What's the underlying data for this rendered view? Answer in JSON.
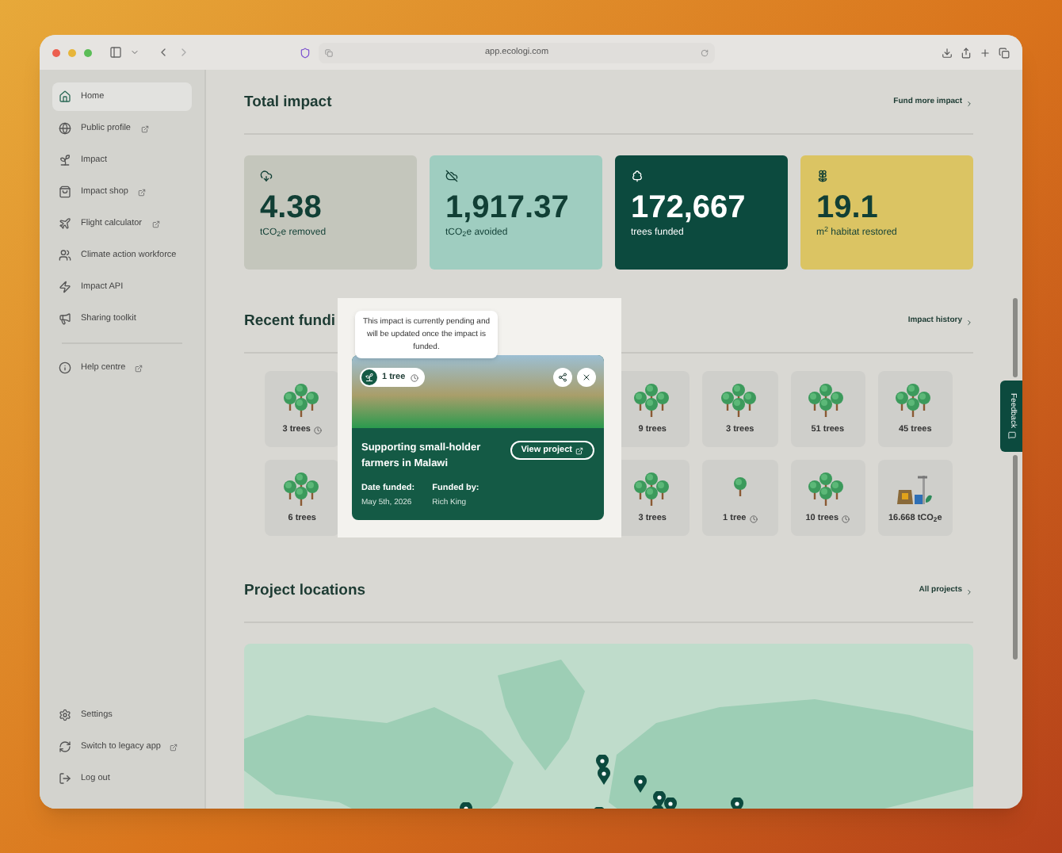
{
  "browser": {
    "url": "app.ecologi.com"
  },
  "sidebar": {
    "items": [
      {
        "label": "Home",
        "selected": true,
        "external": false
      },
      {
        "label": "Public profile",
        "selected": false,
        "external": true
      },
      {
        "label": "Impact",
        "selected": false,
        "external": false
      },
      {
        "label": "Impact shop",
        "selected": false,
        "external": true
      },
      {
        "label": "Flight calculator",
        "selected": false,
        "external": true
      },
      {
        "label": "Climate action workforce",
        "selected": false,
        "external": false
      },
      {
        "label": "Impact API",
        "selected": false,
        "external": false
      },
      {
        "label": "Sharing toolkit",
        "selected": false,
        "external": false
      }
    ],
    "help": [
      {
        "label": "Help centre",
        "selected": false,
        "external": true
      }
    ],
    "footer": [
      {
        "label": "Settings",
        "external": false
      },
      {
        "label": "Switch to legacy app",
        "external": true
      },
      {
        "label": "Log out",
        "external": false
      }
    ]
  },
  "total_impact": {
    "title": "Total impact",
    "link": "Fund more impact",
    "cards": [
      {
        "value": "4.38",
        "label": "tCO$_{2}$e removed",
        "color": "#c4c6bc"
      },
      {
        "value": "1,917.37",
        "label": "tCO$_{2}$e avoided",
        "color": "#9fcdc0"
      },
      {
        "value": "172,667",
        "label": "trees funded",
        "color": "#0c4a3e"
      },
      {
        "value": "19.1",
        "label": "m$^{2}$ habitat restored",
        "color": "#dbc463"
      }
    ]
  },
  "recent_funding": {
    "title": "Recent fundi",
    "link": "Impact history",
    "rows": [
      [
        {
          "label": "3 trees",
          "kind": "trees",
          "pending": true
        },
        {
          "label": "9 trees",
          "kind": "trees",
          "pending": false
        },
        {
          "label": "3 trees",
          "kind": "trees",
          "pending": false
        },
        {
          "label": "51 trees",
          "kind": "trees",
          "pending": false
        },
        {
          "label": "45 trees",
          "kind": "trees",
          "pending": false
        }
      ],
      [
        {
          "label": "6 trees",
          "kind": "trees",
          "pending": false
        },
        {
          "label": "3 trees",
          "kind": "trees",
          "pending": false
        },
        {
          "label": "1 tree",
          "kind": "tree",
          "pending": true
        },
        {
          "label": "10 trees",
          "kind": "trees",
          "pending": true
        },
        {
          "label": "16.668 tCO$_{2}$e",
          "kind": "carbon",
          "pending": false
        }
      ]
    ]
  },
  "popup": {
    "tooltip": "This impact is currently pending and will be updated once the impact is funded.",
    "badge": "1 tree",
    "title": "Supporting small-holder farmers in Malawi",
    "button": "View project",
    "date_label": "Date funded:",
    "date": "May 5th, 2026",
    "funder_label": "Funded by:",
    "funder": "Rich King"
  },
  "project_locations": {
    "title": "Project locations",
    "link": "All projects"
  },
  "feedback": "Feedback"
}
